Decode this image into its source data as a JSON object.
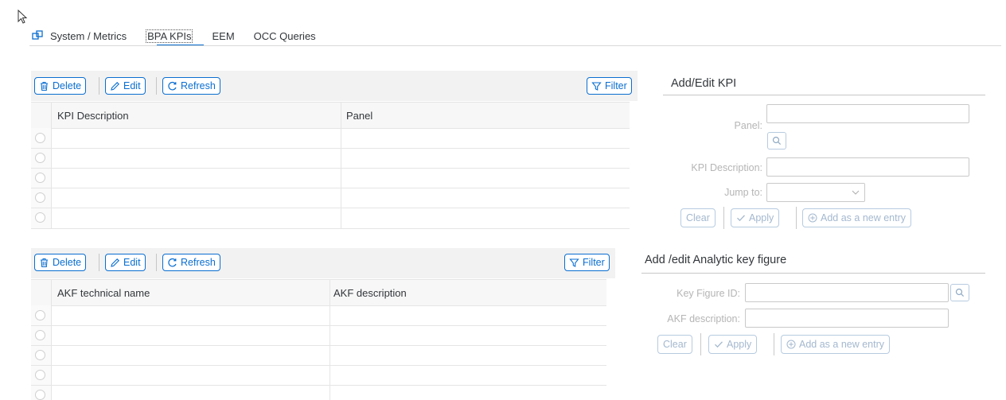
{
  "tabs": {
    "system_metrics": "System / Metrics",
    "bpa_kpis": "BPA KPIs",
    "eem": "EEM",
    "occ_queries": "OCC Queries",
    "active": "BPA KPIs"
  },
  "kpi_table": {
    "toolbar": {
      "delete": "Delete",
      "edit": "Edit",
      "refresh": "Refresh",
      "filter": "Filter"
    },
    "columns": [
      "KPI Description",
      "Panel"
    ],
    "rows": [
      [
        "",
        ""
      ],
      [
        "",
        ""
      ],
      [
        "",
        ""
      ],
      [
        "",
        ""
      ],
      [
        "",
        ""
      ]
    ]
  },
  "akf_table": {
    "toolbar": {
      "delete": "Delete",
      "edit": "Edit",
      "refresh": "Refresh",
      "filter": "Filter"
    },
    "columns": [
      "AKF technical name",
      "AKF description"
    ],
    "rows": [
      [
        "",
        ""
      ],
      [
        "",
        ""
      ],
      [
        "",
        ""
      ],
      [
        "",
        ""
      ],
      [
        "",
        ""
      ]
    ]
  },
  "kpi_form": {
    "title": "Add/Edit KPI",
    "panel_label": "Panel:",
    "panel_value": "",
    "kpi_description_label": "KPI Description:",
    "kpi_description_value": "",
    "jump_to_label": "Jump to:",
    "jump_to_value": "",
    "clear": "Clear",
    "apply": "Apply",
    "add_new": "Add as a new entry"
  },
  "akf_form": {
    "title": "Add /edit Analytic key figure",
    "key_figure_id_label": "Key Figure ID:",
    "key_figure_id_value": "",
    "akf_description_label": "AKF description:",
    "akf_description_value": "",
    "clear": "Clear",
    "apply": "Apply",
    "add_new": "Add as a new entry"
  },
  "colors": {
    "accent": "#0a6ed1",
    "disabled_text": "#b5b5b5",
    "disabled_button": "#a4b8cf",
    "toolbar_bg": "#f2f2f2"
  }
}
